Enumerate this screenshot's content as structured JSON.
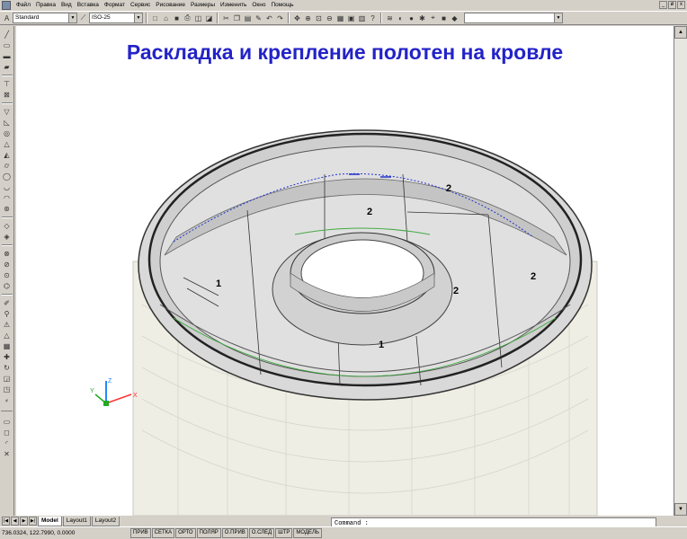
{
  "menu": {
    "items": [
      "Файл",
      "Правка",
      "Вид",
      "Вставка",
      "Формат",
      "Сервис",
      "Рисование",
      "Размеры",
      "Изменить",
      "Окно",
      "Помощь"
    ],
    "window_controls": [
      "_",
      "ø",
      "x"
    ]
  },
  "toolbar": {
    "text_style": "Standard",
    "dim_style": "ISO-25"
  },
  "drawing": {
    "title": "Раскладка и крепление полотен на кровле",
    "labels": {
      "l1": "1",
      "l2": "2",
      "l3": "2",
      "l4": "2",
      "l5": "2",
      "l6": "1"
    },
    "ucs": {
      "x": "X",
      "y": "Y",
      "z": "Z"
    }
  },
  "layout_tabs": {
    "tabs": [
      "Model",
      "Layout1",
      "Layout2"
    ],
    "active": "Model"
  },
  "command": {
    "prompt": "Command :"
  },
  "status": {
    "coordinates": "736.0324, 122.7990, 0.0000",
    "buttons": [
      "ПРИВ",
      "СЕТКА",
      "ОРТО",
      "ПОЛЯР",
      "О.ПРИВ",
      "О.СЛЕД",
      "ШТР",
      "МОДЕЛЬ"
    ]
  },
  "colors": {
    "title": "#2323c8",
    "roof_fill": "#d8d8d8",
    "wall_fill": "#efeee4"
  }
}
